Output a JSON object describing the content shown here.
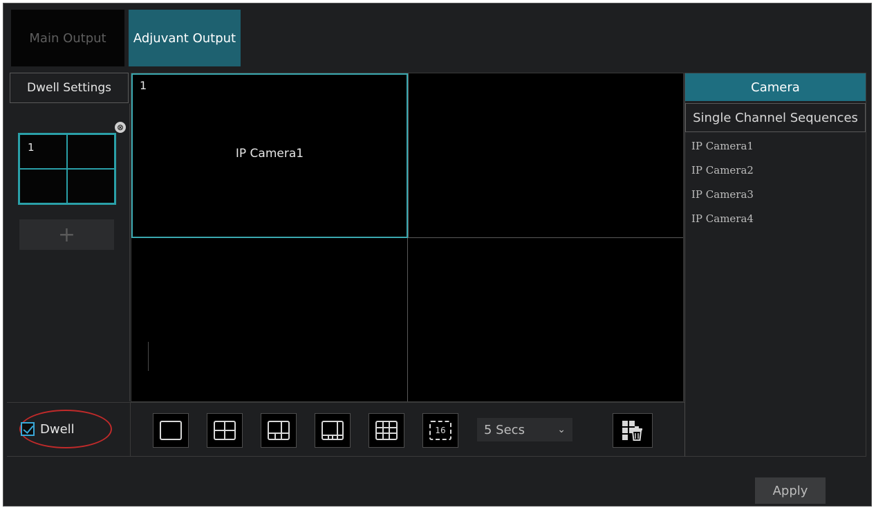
{
  "tabs": {
    "main_output": "Main Output",
    "adjuvant_output": "Adjuvant Output"
  },
  "left": {
    "dwell_settings": "Dwell Settings",
    "thumb_number": "1",
    "close_symbol": "⊗",
    "add_symbol": "+"
  },
  "video": {
    "pane1_number": "1",
    "pane1_camera": "IP Camera1"
  },
  "right": {
    "camera_tab": "Camera",
    "sequences_tab": "Single Channel Sequences",
    "cameras": [
      "IP Camera1",
      "IP Camera2",
      "IP Camera3",
      "IP Camera4"
    ]
  },
  "bottom": {
    "dwell_label": "Dwell",
    "dwell_checked": true,
    "interval": "5 Secs",
    "interval_arrow": "⌄",
    "layout_16_label": "16",
    "apply": "Apply"
  },
  "colors": {
    "accent": "#1e6e80",
    "highlight_border": "#3aa8b0",
    "annotation_red": "#c02a2a",
    "background": "#1e1f21"
  },
  "icons": [
    "layout-1-icon",
    "layout-4-icon",
    "layout-6-icon",
    "layout-8-icon",
    "layout-9-icon",
    "layout-16-icon",
    "clear-layout-icon",
    "checkbox-icon",
    "add-icon",
    "close-icon"
  ]
}
